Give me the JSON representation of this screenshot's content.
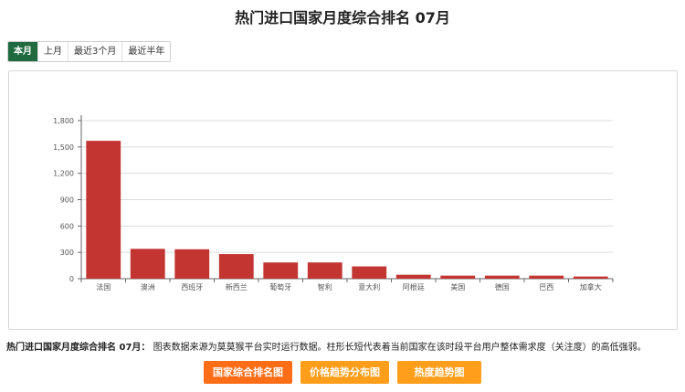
{
  "header": {
    "title": "热门进口国家月度综合排名 07月"
  },
  "tabs": [
    {
      "label": "本月",
      "active": true
    },
    {
      "label": "上月",
      "active": false
    },
    {
      "label": "最近3个月",
      "active": false
    },
    {
      "label": "最近半年",
      "active": false
    }
  ],
  "chart_data": {
    "type": "bar",
    "categories": [
      "法国",
      "澳洲",
      "西班牙",
      "新西兰",
      "葡萄牙",
      "智利",
      "意大利",
      "阿根廷",
      "美国",
      "德国",
      "巴西",
      "加拿大"
    ],
    "values": [
      1570,
      340,
      335,
      280,
      185,
      185,
      140,
      45,
      35,
      35,
      35,
      25
    ],
    "ylim": [
      0,
      1800
    ],
    "yticks": [
      0,
      300,
      600,
      900,
      1200,
      1500,
      1800
    ],
    "ytick_labels": [
      "0",
      "300",
      "600",
      "900",
      "1,200",
      "1,500",
      "1,800"
    ],
    "bar_color": "#c23531",
    "grid": true,
    "title": "",
    "xlabel": "",
    "ylabel": ""
  },
  "description": {
    "strong": "热门进口国家月度综合排名 07月：",
    "text": "图表数据来源为莫莫猴平台实时运行数据。柱形长短代表着当前国家在该时段平台用户整体需求度（关注度）的高低强弱。"
  },
  "actions": [
    {
      "label": "国家综合排名图",
      "color": "#ff6d17"
    },
    {
      "label": "价格趋势分布图",
      "color": "#ff9e1b"
    },
    {
      "label": "热度趋势图",
      "color": "#ff9e1b"
    }
  ]
}
